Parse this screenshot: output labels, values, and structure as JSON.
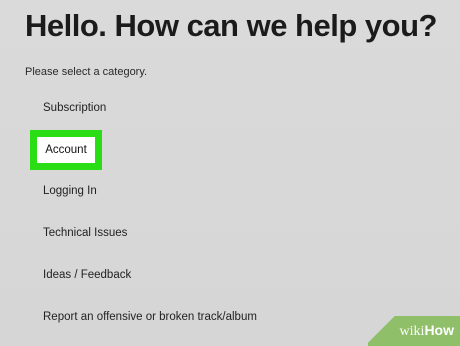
{
  "header": {
    "title": "Hello. How can we help you?",
    "subtitle": "Please select a category."
  },
  "categories": [
    {
      "label": "Subscription",
      "highlighted": false
    },
    {
      "label": "Account",
      "highlighted": true
    },
    {
      "label": "Logging In",
      "highlighted": false
    },
    {
      "label": "Technical Issues",
      "highlighted": false
    },
    {
      "label": "Ideas / Feedback",
      "highlighted": false
    },
    {
      "label": "Report an offensive or broken track/album",
      "highlighted": false
    }
  ],
  "watermark": {
    "prefix": "wiki",
    "suffix": "How"
  },
  "colors": {
    "highlight_border": "#2bdd14",
    "highlight_fill": "#ffffff",
    "background": "#d8d8d8",
    "watermark_bg": "#8fbf68"
  }
}
